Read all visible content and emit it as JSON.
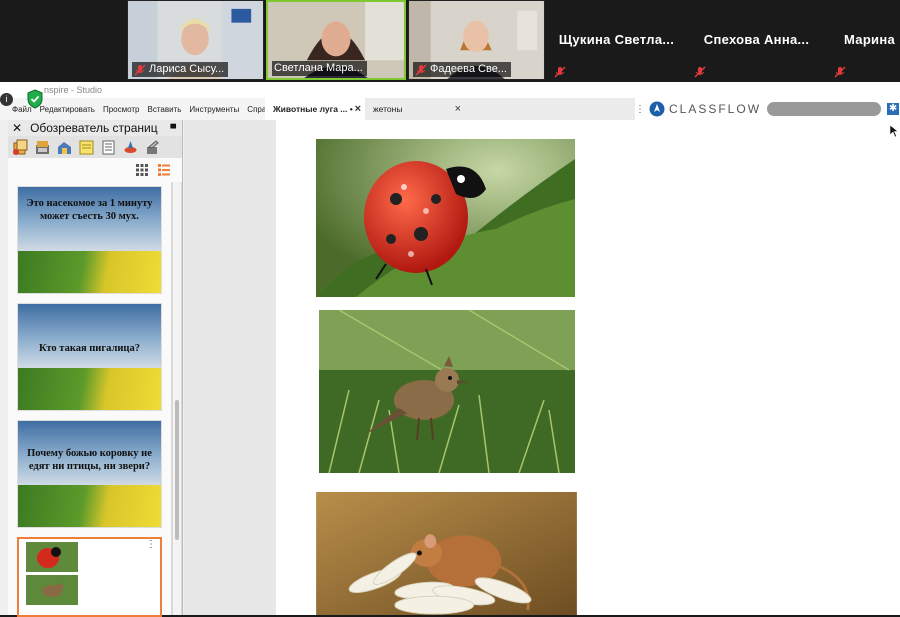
{
  "meeting": {
    "participants": [
      {
        "name": "Лариса Сысу...",
        "video": true,
        "muted": true
      },
      {
        "name": "Светлана Мара...",
        "video": true,
        "muted": false,
        "active": true
      },
      {
        "name": "Фадеева Све...",
        "video": true,
        "muted": true
      },
      {
        "name": "Щукина  Светла...",
        "video": false,
        "muted": true
      },
      {
        "name": "Спехова  Анна...",
        "video": false,
        "muted": true
      },
      {
        "name": "Марина",
        "video": false,
        "muted": true
      }
    ]
  },
  "app": {
    "title": "nspire - Studio",
    "menu": [
      "Файл",
      "Редактировать",
      "Просмотр",
      "Вставить",
      "Инструменты",
      "Справка"
    ],
    "tabs": [
      {
        "label": "Животные луга ... •",
        "active": true
      },
      {
        "label": "жетоны",
        "active": false
      }
    ],
    "classflow": "CLASSFLOW"
  },
  "page_browser": {
    "title": "Обозреватель страниц",
    "slides": [
      {
        "text": "Это насекомое за 1 минуту может съесть 30 мух."
      },
      {
        "text": "Кто такая пигалица?"
      },
      {
        "text": "Почему божью коровку не едят ни птицы, ни звери?"
      }
    ]
  },
  "canvas": {
    "images": [
      "ladybug-photo",
      "lark-photo",
      "harvest-mouse-photo"
    ]
  },
  "colors": {
    "accent": "#f07d3a",
    "active_speaker": "#7ec832",
    "shield": "#1fae4a"
  }
}
